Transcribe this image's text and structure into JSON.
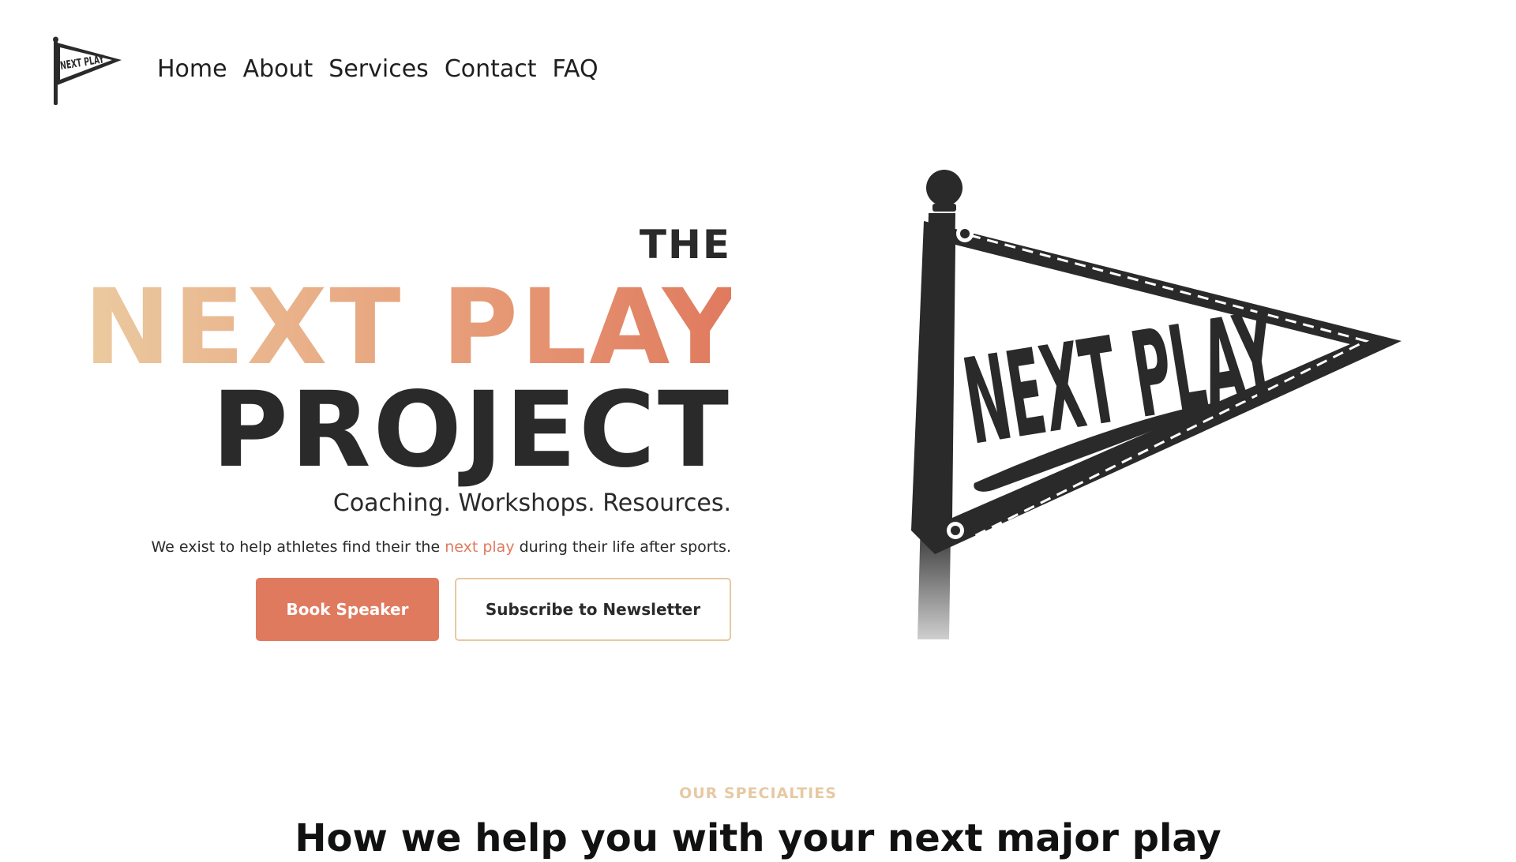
{
  "brand": {
    "logo_text": "NEXT PLAY"
  },
  "nav": {
    "items": [
      "Home",
      "About",
      "Services",
      "Contact",
      "FAQ"
    ]
  },
  "hero": {
    "line_the": "THE",
    "line_next_play": "NEXT PLAY",
    "line_project": "PROJECT",
    "tagline": "Coaching. Workshops. Resources.",
    "mission_before": "We exist to help athletes find their the ",
    "mission_accent": "next play",
    "mission_after": " during their life after sports.",
    "primary_button": "Book Speaker",
    "secondary_button": "Subscribe to Newsletter",
    "pennant_text": "NEXT PLAY"
  },
  "specialties": {
    "eyebrow": "OUR SPECIALTIES",
    "title": "How we help you with your next major play"
  },
  "colors": {
    "accent": "#e07a5f",
    "accent_light": "#ebcaa0",
    "dark": "#2a2a2a",
    "secondary_border": "#e6c9a3"
  },
  "icons": {
    "logo": "pennant-flag-icon",
    "hero_art": "pennant-flag-illustration"
  }
}
